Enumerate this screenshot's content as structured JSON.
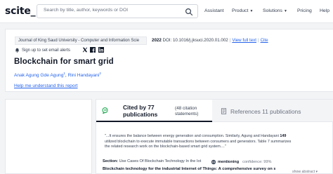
{
  "brand": {
    "logo": "scite_"
  },
  "search": {
    "placeholder": "Search by title, author, keywords or DOI"
  },
  "nav": {
    "assistant": "Assistant",
    "product": "Product",
    "solutions": "Solutions",
    "pricing": "Pricing",
    "help": "Help"
  },
  "article": {
    "journal": "Journal of King Saud University - Computer and Information Scie",
    "year": "2022",
    "doi": "DOI: 10.1016/j.jksuci.2020.01.002",
    "view_full_text": "View full text",
    "cite": "Cite",
    "signup": "Sign up to set email alerts",
    "title": "Blockchain for smart grid",
    "authors": [
      {
        "name": "Anak Agung Gde Agung",
        "sup": "1"
      },
      {
        "name": "Rini Handayani",
        "sup": "2"
      }
    ],
    "help_link": "Help me understand this report"
  },
  "tabs": {
    "cited_by": "Cited by 77 publications",
    "citation_statements": "(48 citation statements)",
    "references": "References 11 publications"
  },
  "citation": {
    "snippet_start": "\"...It ensures the balance between energy generation and consumption. Similarly, Agung and Handayani ",
    "snippet_ref": "149",
    "snippet_end": " utilized blockchain to execute immutable transactions between consumers and generators. Table 7 summarizes the related research work on the blockchain-based smart grid system....\"",
    "section_label": "Section:",
    "section_value": "Use Cases Of Blockchain Technology In the Iot",
    "mention_label": "mentioning",
    "confidence": "confidence: 99%",
    "citing_title": "Blockchain technology for the industrial Internet of Things: A comprehensive survey on security",
    "show_abstract": "show abstract"
  },
  "colors": {
    "link": "#2563eb",
    "brand": "#111827",
    "mention": "#4b5563"
  }
}
